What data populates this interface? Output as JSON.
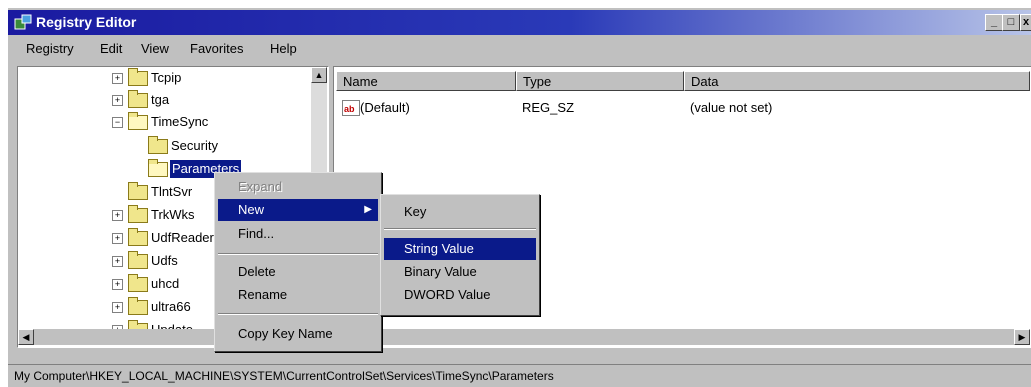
{
  "window": {
    "title": "Registry Editor",
    "minimize": "_",
    "maximize": "□",
    "close": "x"
  },
  "menubar": [
    "Registry",
    "Edit",
    "View",
    "Favorites",
    "Help"
  ],
  "tree": [
    {
      "label": "Tcpip",
      "expander": "+"
    },
    {
      "label": "tga",
      "expander": "+"
    },
    {
      "label": "TimeSync",
      "expander": "−"
    },
    {
      "label": "Security",
      "expander": ""
    },
    {
      "label": "Parameters",
      "expander": ""
    },
    {
      "label": "TlntSvr",
      "expander": ""
    },
    {
      "label": "TrkWks",
      "expander": "+"
    },
    {
      "label": "UdfReader",
      "expander": "+"
    },
    {
      "label": "Udfs",
      "expander": "+"
    },
    {
      "label": "uhcd",
      "expander": "+"
    },
    {
      "label": "ultra66",
      "expander": "+"
    },
    {
      "label": "Update",
      "expander": "+"
    }
  ],
  "list": {
    "columns": [
      "Name",
      "Type",
      "Data"
    ],
    "rows": [
      {
        "icon": "string-value-icon",
        "name": "(Default)",
        "type": "REG_SZ",
        "data": "(value not set)"
      }
    ]
  },
  "context_menu": {
    "items": [
      "Expand",
      "New",
      "Find...",
      "Delete",
      "Rename",
      "Copy Key Name"
    ],
    "disabled": "Expand",
    "selected": "New"
  },
  "submenu": {
    "items": [
      "Key",
      "String Value",
      "Binary Value",
      "DWORD Value"
    ],
    "selected": "String Value"
  },
  "statusbar": {
    "path": "My Computer\\HKEY_LOCAL_MACHINE\\SYSTEM\\CurrentControlSet\\Services\\TimeSync\\Parameters"
  },
  "colors": {
    "titlebar": "#1a1aa0",
    "highlight": "#0a1a8a",
    "chrome": "#c0c0c0"
  }
}
